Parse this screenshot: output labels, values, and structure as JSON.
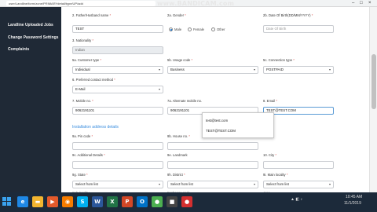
{
  "browser": {
    "url": "user/Landline/form/zone/PRIMARYdetail/type/UP/add",
    "watermark": "www.BANDICAM.com"
  },
  "sidebar": {
    "items": [
      {
        "label": "Landline Uploaded Jobs"
      },
      {
        "label": "Change Password Settings"
      },
      {
        "label": "Complaints"
      }
    ]
  },
  "form": {
    "fathers_name": {
      "label": "Father/Husband name",
      "value": "TEST"
    },
    "gender": {
      "label": "Gender",
      "options": [
        "Male",
        "Female",
        "Other"
      ],
      "selected": "Male"
    },
    "dob": {
      "label": "Date Of Birth(DD/MM/YYYY)",
      "placeholder": "Date Of Birth"
    },
    "nationality": {
      "label": "Nationality",
      "value": "Indian"
    },
    "customer_type": {
      "label": "Customer type",
      "value": "Individual"
    },
    "usage_code": {
      "label": "Usage code",
      "value": "Business"
    },
    "connection_type": {
      "label": "Connection type",
      "value": "POSTPAID"
    },
    "contact_method": {
      "label": "Preferred contact method",
      "value": "E-Mail"
    },
    "mobile": {
      "label": "Mobile no.",
      "value": "9062191101"
    },
    "alt_mobile": {
      "label": "Alternate mobile no.",
      "value": "9062191101"
    },
    "email": {
      "label": "Email",
      "value": "TEST@TEST.COM"
    },
    "installation_title": "Installation address details",
    "pin_code": {
      "label": "Pin code"
    },
    "house_no": {
      "label": "House no."
    },
    "additional": {
      "label": "Additional Details"
    },
    "landmark": {
      "label": "Landmark"
    },
    "city": {
      "label": "City"
    },
    "state": {
      "label": "State",
      "value": "Select from list"
    },
    "district": {
      "label": "District",
      "value": "Select from list"
    },
    "main_locality": {
      "label": "Main locality",
      "value": "Select from list"
    },
    "next_row": {
      "a": "Sub locality",
      "b": "Exchange code",
      "c": "Area"
    }
  },
  "numbers": {
    "fathers": "2.",
    "gender": "2a.",
    "dob": "2b.",
    "nationality": "3.",
    "customer": "5a.",
    "usage": "5b.",
    "connection": "5c.",
    "contact": "6.",
    "mobile": "7.",
    "alt": "7a.",
    "email": "8.",
    "pin": "9a.",
    "house": "9b.",
    "additional": "9c.",
    "landmark": "9e.",
    "city": "10.",
    "state": "9g.",
    "district": "9h.",
    "locality": "9i."
  },
  "autocomplete": [
    "test@test.com",
    "TEST@TEST.COM"
  ],
  "taskbar": {
    "icons": [
      {
        "name": "ie-icon",
        "glyph": "e",
        "color": "#1e88e5"
      },
      {
        "name": "folder-icon",
        "glyph": "▬",
        "color": "#f2b530"
      },
      {
        "name": "media-icon",
        "glyph": "▶",
        "color": "#e35a2b"
      },
      {
        "name": "firefox-icon",
        "glyph": "◉",
        "color": "#f57c00"
      },
      {
        "name": "skype-icon",
        "glyph": "S",
        "color": "#00aff0"
      },
      {
        "name": "word-icon",
        "glyph": "W",
        "color": "#2b579a"
      },
      {
        "name": "excel-icon",
        "glyph": "X",
        "color": "#217346"
      },
      {
        "name": "powerpoint-icon",
        "glyph": "P",
        "color": "#d24726"
      },
      {
        "name": "outlook-icon",
        "glyph": "O",
        "color": "#0072c6"
      },
      {
        "name": "chrome-icon",
        "glyph": "●",
        "color": "#4caf50"
      },
      {
        "name": "camera-icon",
        "glyph": "■",
        "color": "#444"
      },
      {
        "name": "bandicam-icon",
        "glyph": "●",
        "color": "#d32f2f"
      }
    ],
    "time": "10:45 AM",
    "date": "11/1/2019"
  },
  "colors": {
    "sidebar": "#1f2936",
    "link": "#3a8dde",
    "taskbar": "#1c2a3a"
  }
}
